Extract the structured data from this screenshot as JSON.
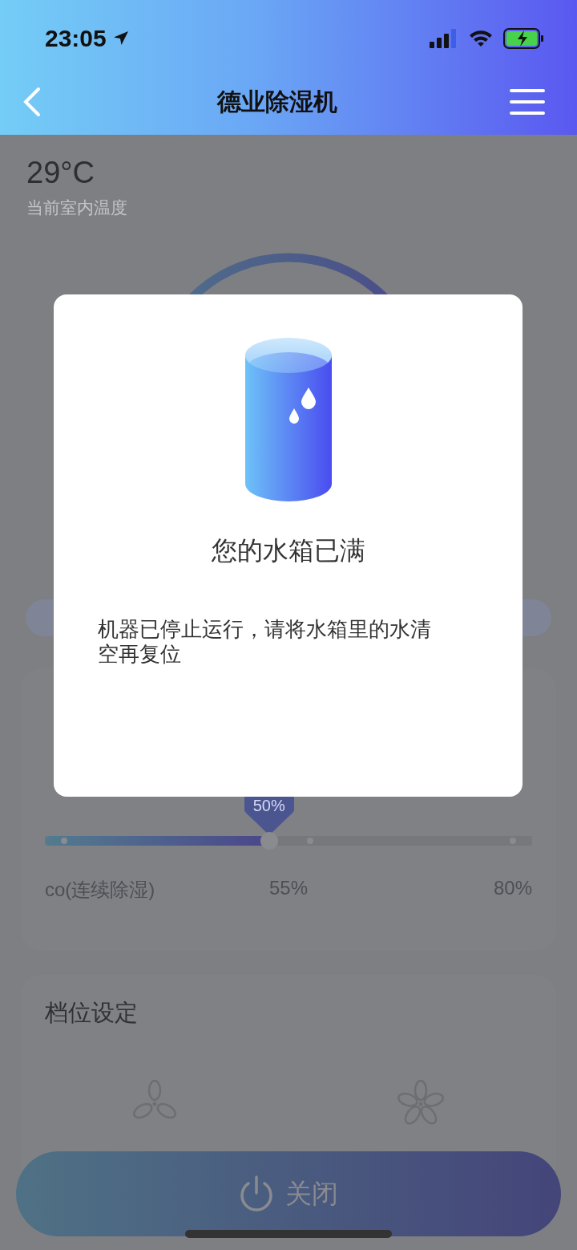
{
  "status_bar": {
    "time": "23:05"
  },
  "nav": {
    "title": "德业除湿机"
  },
  "temperature": {
    "value": "29°C",
    "label": "当前室内温度"
  },
  "humidity": {
    "pin": "50%",
    "level": 0.46,
    "ticks": [
      "co(连续除湿)",
      "55%",
      "80%"
    ]
  },
  "fan_speed": {
    "title": "档位设定"
  },
  "power_button": {
    "label": "关闭"
  },
  "dialog": {
    "title": "您的水箱已满",
    "message": "机器已停止运行，请将水箱里的水清空再复位"
  }
}
